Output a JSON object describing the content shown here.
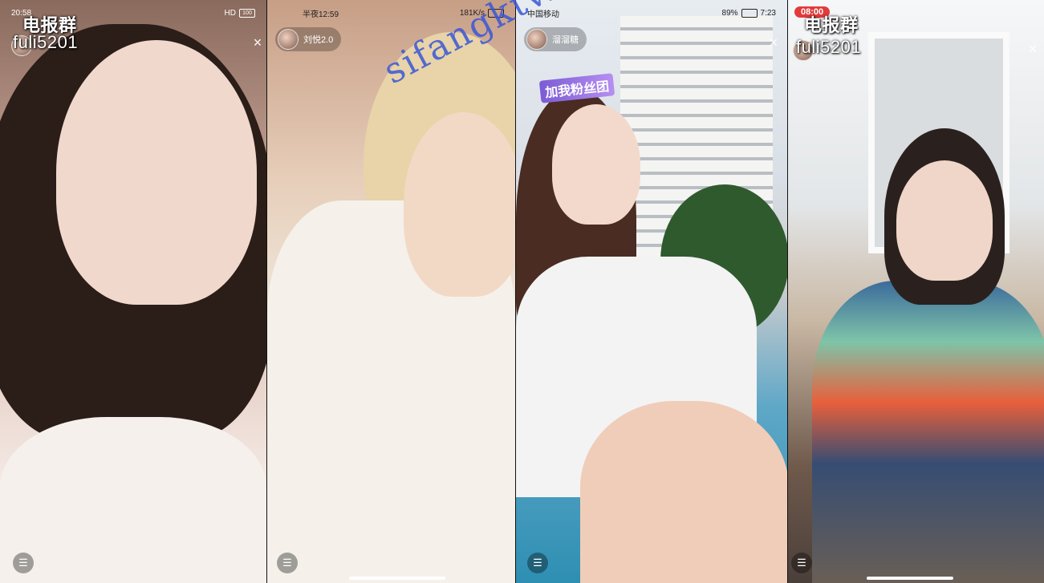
{
  "overlays": {
    "channel_label": "电报群",
    "handle": "fuli5201",
    "watermark": "sifangktv.com"
  },
  "panels": [
    {
      "status_time": "20:58",
      "status_right": "HD",
      "battery": "100",
      "close_glyph": "×",
      "chat_icon": "message-icon"
    },
    {
      "status_time": "半夜12:59",
      "status_speed": "181K/s",
      "host_name": "刘悦2.0",
      "close_glyph": "",
      "chat_icon": "message-icon"
    },
    {
      "status_carrier": "中国移动",
      "status_battery_pct": "89%",
      "status_time": "7:23",
      "host_name": "溜溜糖",
      "fan_badge": "加我粉丝团",
      "close_glyph": "×",
      "chat_icon": "message-icon"
    },
    {
      "live_badge": "08:00",
      "close_glyph": "×",
      "chat_icon": "message-icon"
    }
  ]
}
